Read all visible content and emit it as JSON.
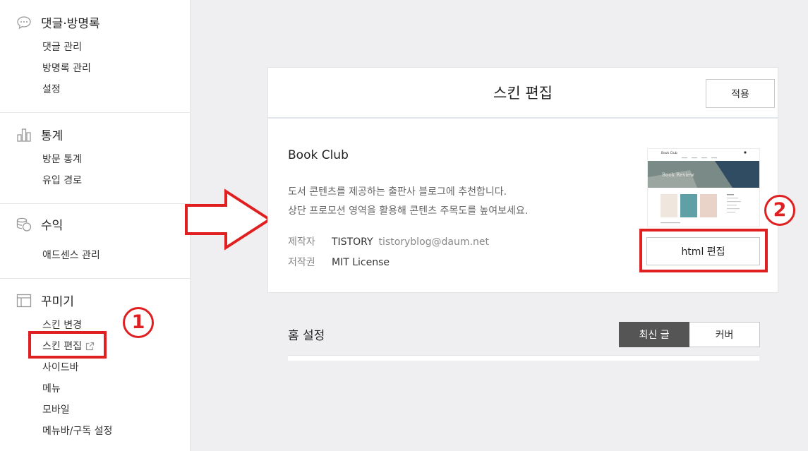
{
  "sidebar": {
    "sections": [
      {
        "label": "댓글·방명록",
        "icon": "speech-bubble-icon",
        "items": [
          "댓글 관리",
          "방명록 관리",
          "설정"
        ]
      },
      {
        "label": "통계",
        "icon": "bar-chart-icon",
        "items": [
          "방문 통계",
          "유입 경로"
        ]
      },
      {
        "label": "수익",
        "icon": "coins-icon",
        "items": [
          "애드센스 관리"
        ]
      },
      {
        "label": "꾸미기",
        "icon": "layout-icon",
        "items": [
          "스킨 변경",
          "스킨 편집",
          "사이드바",
          "메뉴",
          "모바일",
          "메뉴바/구독 설정"
        ]
      }
    ]
  },
  "skin_editor": {
    "title": "스킨 편집",
    "apply_label": "적용",
    "skin_name": "Book Club",
    "description_line1": "도서 콘텐츠를 제공하는 출판사 블로그에 추천합니다.",
    "description_line2": "상단 프로모션 영역을 활용해 콘텐츠 주목도를 높여보세요.",
    "maker_label": "제작자",
    "maker_name": "TISTORY",
    "maker_email": "tistoryblog@daum.net",
    "license_label": "저작권",
    "license_value": "MIT License",
    "html_edit_label": "html 편집",
    "thumbnail": {
      "site_title": "Book Club",
      "banner_text": "Book Review"
    }
  },
  "home_settings": {
    "title": "홈 설정",
    "options": [
      "최신 글",
      "커버"
    ],
    "selected": "최신 글"
  },
  "annotations": {
    "step1": "1",
    "step2": "2",
    "color": "#e02020"
  }
}
